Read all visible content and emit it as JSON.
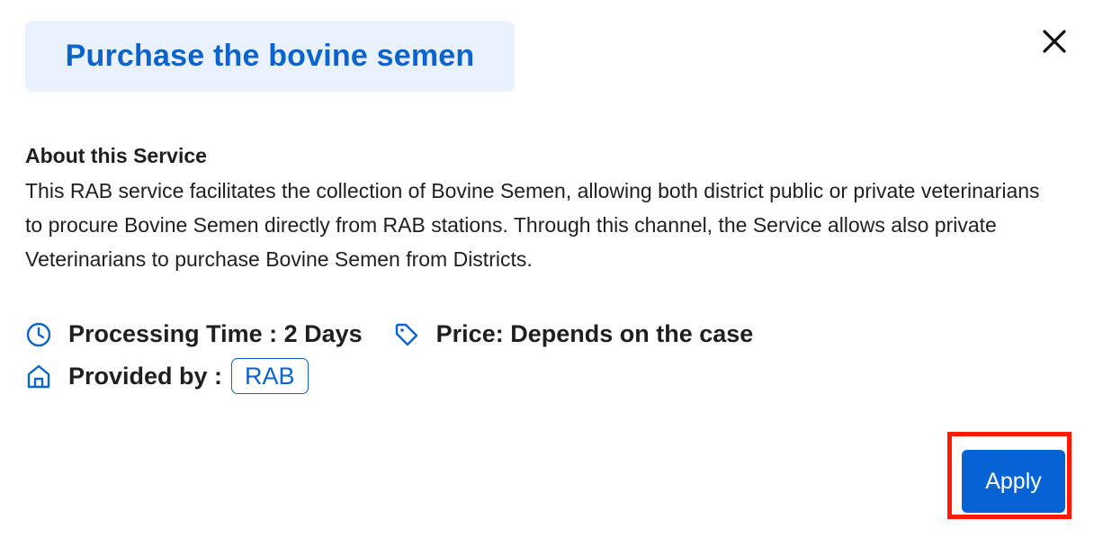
{
  "dialog": {
    "title": "Purchase the bovine semen",
    "close_icon": "close-icon"
  },
  "about": {
    "heading": "About this Service",
    "description": "This RAB service facilitates the collection of Bovine Semen, allowing both district public or private veterinarians to procure Bovine Semen directly from RAB stations. Through this channel, the Service allows also private Veterinarians to purchase Bovine Semen from Districts."
  },
  "details": {
    "processing_time": "Processing Time : 2 Days",
    "price": "Price: Depends on the case",
    "provided_by_label": "Provided by :",
    "provider": "RAB"
  },
  "icons": {
    "clock": "clock-icon",
    "price_tag": "price-tag-icon",
    "home": "home-icon"
  },
  "actions": {
    "apply_label": "Apply"
  },
  "colors": {
    "accent": "#0b63ce",
    "title_bg": "#e9f1fc",
    "button_bg": "#0763d3",
    "highlight": "#ff1a00"
  }
}
